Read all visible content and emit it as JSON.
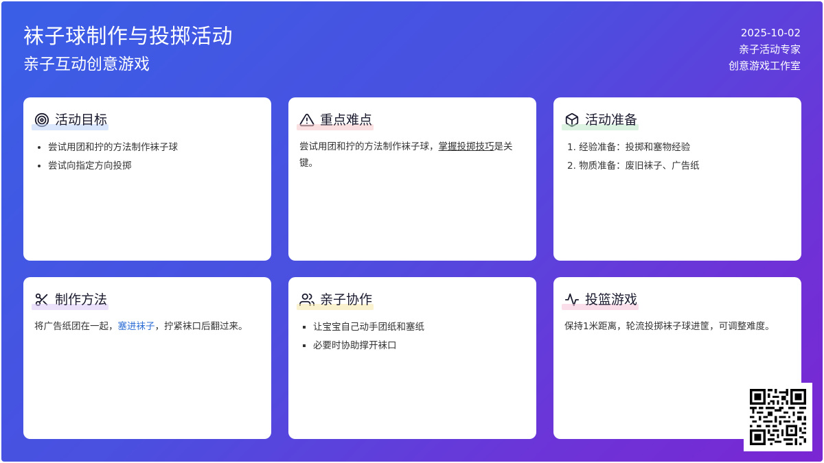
{
  "header": {
    "title": "袜子球制作与投掷活动",
    "subtitle": "亲子互动创意游戏",
    "date": "2025-10-02",
    "author": "亲子活动专家",
    "org": "创意游戏工作室"
  },
  "cards": {
    "goal": {
      "icon": "target-icon",
      "title": "活动目标",
      "items": [
        "尝试用团和拧的方法制作袜子球",
        "尝试向指定方向投掷"
      ]
    },
    "difficulty": {
      "icon": "warning-triangle-icon",
      "title": "重点难点",
      "text_before": "尝试用团和拧的方法制作袜子球，",
      "text_underlined": "掌握投掷技巧",
      "text_after": "是关键。"
    },
    "prep": {
      "icon": "box-icon",
      "title": "活动准备",
      "items": [
        "1. 经验准备：投掷和塞物经验",
        "2. 物质准备：废旧袜子、广告纸"
      ]
    },
    "method": {
      "icon": "scissors-icon",
      "title": "制作方法",
      "text_before": "将广告纸团在一起，",
      "text_link": "塞进袜子",
      "text_after": "，拧紧袜口后翻过来。"
    },
    "coop": {
      "icon": "users-icon",
      "title": "亲子协作",
      "items": [
        "让宝宝自己动手团纸和塞纸",
        "必要时协助撑开袜口"
      ]
    },
    "game": {
      "icon": "activity-icon",
      "title": "投篮游戏",
      "text": "保持1米距离，轮流投掷袜子球进筐，可调整难度。"
    }
  },
  "colors": {
    "gradient_start": "#3a5fe6",
    "gradient_end": "#7a26d2",
    "link": "#2f6fd6"
  },
  "qr": {
    "icon": "qr-code-icon"
  }
}
